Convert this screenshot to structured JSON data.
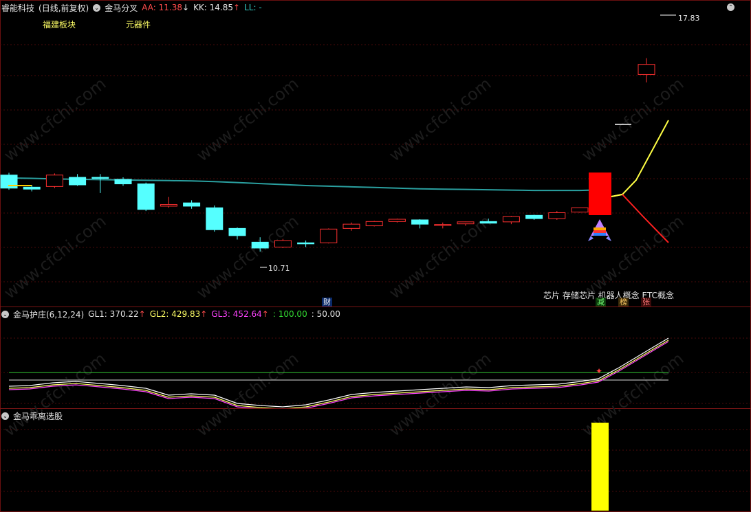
{
  "main": {
    "stock": "睿能科技",
    "mode": "(日线,前复权)",
    "indicator": "金马分叉",
    "aa_label": "AA:",
    "aa_value": "11.38",
    "aa_arrow": "↓",
    "kk_label": "KK:",
    "kk_value": "14.85",
    "kk_arrow": "↑",
    "ll_label": "LL:",
    "ll_value": "-",
    "sector1": "福建板块",
    "sector2": "元器件",
    "high_marker": "17.83",
    "low_marker": "10.71",
    "concepts": "芯片 存储芯片 机器人概念 ETC概念",
    "badge_cai": "财",
    "badge_jian": "减",
    "badge_bang": "榜",
    "badge_zhang": "张"
  },
  "sub1": {
    "title": "金马护庄(6,12,24)",
    "gl1_label": "GL1:",
    "gl1_value": "370.22",
    "gl1_arrow": "↑",
    "gl2_label": "GL2:",
    "gl2_value": "429.83",
    "gl2_arrow": "↑",
    "gl3_label": "GL3:",
    "gl3_value": "452.64",
    "gl3_arrow": "↑",
    "line100": ": 100.00",
    "line50": ": 50.00"
  },
  "sub2": {
    "title": "金马乖离选股"
  },
  "watermark": "www.cfchi.com",
  "colors": {
    "up": "#ff3030",
    "down": "#55ffff",
    "ma": "#2aa0a0",
    "proj_up": "#ffff44",
    "proj_down": "#ff2020",
    "signal_bar": "#ffff00"
  },
  "chart_data": {
    "type": "candlestick",
    "candles": [
      {
        "o": 13.05,
        "h": 13.12,
        "l": 12.6,
        "c": 12.65
      },
      {
        "o": 12.68,
        "h": 12.75,
        "l": 12.55,
        "c": 12.62
      },
      {
        "o": 12.7,
        "h": 13.1,
        "l": 12.65,
        "c": 13.05
      },
      {
        "o": 12.98,
        "h": 13.08,
        "l": 12.72,
        "c": 12.75
      },
      {
        "o": 12.98,
        "h": 13.08,
        "l": 12.5,
        "c": 12.95
      },
      {
        "o": 12.92,
        "h": 12.98,
        "l": 12.72,
        "c": 12.78
      },
      {
        "o": 12.78,
        "h": 12.82,
        "l": 11.95,
        "c": 12.0
      },
      {
        "o": 12.1,
        "h": 12.38,
        "l": 12.05,
        "c": 12.15
      },
      {
        "o": 12.2,
        "h": 12.28,
        "l": 12.02,
        "c": 12.1
      },
      {
        "o": 12.05,
        "h": 12.12,
        "l": 11.32,
        "c": 11.38
      },
      {
        "o": 11.42,
        "h": 11.45,
        "l": 11.08,
        "c": 11.2
      },
      {
        "o": 11.0,
        "h": 11.15,
        "l": 10.71,
        "c": 10.82
      },
      {
        "o": 10.85,
        "h": 11.1,
        "l": 10.82,
        "c": 11.05
      },
      {
        "o": 10.98,
        "h": 11.05,
        "l": 10.85,
        "c": 10.95
      },
      {
        "o": 10.98,
        "h": 11.42,
        "l": 10.96,
        "c": 11.4
      },
      {
        "o": 11.42,
        "h": 11.6,
        "l": 11.35,
        "c": 11.55
      },
      {
        "o": 11.5,
        "h": 11.65,
        "l": 11.48,
        "c": 11.63
      },
      {
        "o": 11.63,
        "h": 11.72,
        "l": 11.6,
        "c": 11.7
      },
      {
        "o": 11.68,
        "h": 11.7,
        "l": 11.42,
        "c": 11.55
      },
      {
        "o": 11.52,
        "h": 11.6,
        "l": 11.42,
        "c": 11.54
      },
      {
        "o": 11.56,
        "h": 11.63,
        "l": 11.5,
        "c": 11.62
      },
      {
        "o": 11.63,
        "h": 11.72,
        "l": 11.58,
        "c": 11.58
      },
      {
        "o": 11.62,
        "h": 11.8,
        "l": 11.55,
        "c": 11.78
      },
      {
        "o": 11.82,
        "h": 11.84,
        "l": 11.68,
        "c": 11.72
      },
      {
        "o": 11.72,
        "h": 11.95,
        "l": 11.68,
        "c": 11.9
      },
      {
        "o": 11.92,
        "h": 12.05,
        "l": 11.9,
        "c": 12.05
      },
      {
        "o": 12.05,
        "h": 12.92,
        "l": 12.05,
        "c": 12.92
      },
      {
        "o": 16.12,
        "h": 16.62,
        "l": 15.88,
        "c": 16.43
      }
    ],
    "ma": [
      12.96,
      12.95,
      12.93,
      12.92,
      12.91,
      12.9,
      12.89,
      12.88,
      12.87,
      12.85,
      12.82,
      12.79,
      12.76,
      12.73,
      12.71,
      12.69,
      12.67,
      12.65,
      12.63,
      12.62,
      12.61,
      12.6,
      12.59,
      12.58,
      12.58,
      12.58,
      12.6
    ],
    "ylim": [
      10.0,
      17.83
    ]
  }
}
